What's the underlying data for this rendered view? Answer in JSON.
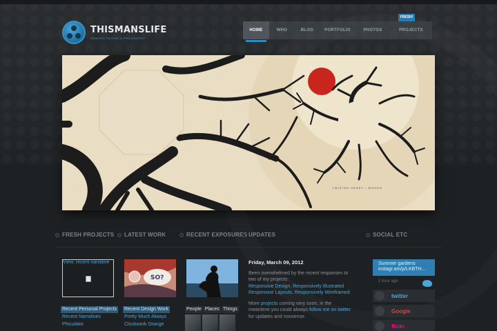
{
  "header": {
    "brand": "THISMANSLIFE",
    "tagline": "GRAPHIC DESIGN & PHILOSOPHY",
    "nav": [
      {
        "label": "HOME",
        "active": true
      },
      {
        "label": "WHO",
        "active": false
      },
      {
        "label": "BLOG",
        "active": false
      },
      {
        "label": "PORTFOLIO",
        "active": false
      },
      {
        "label": "PHOTOS",
        "active": false
      },
      {
        "label": "PROJECTS",
        "active": false
      }
    ],
    "badge": "FRESH!"
  },
  "hero": {
    "caption": "TWISTED HEART • WOODS",
    "colors": {
      "paper": "#e8dcc2",
      "ink": "#1c1c1c",
      "sun": "#c8261c"
    }
  },
  "sections": {
    "fresh_projects": "FRESH PROJECTS",
    "latest_work": "LATEST WORK",
    "recent_exposures": "RECENT EXPOSURES",
    "updates": "UPDATES",
    "social": "SOCIAL ETC"
  },
  "projects": {
    "alt_text": "View: recent narrative",
    "label": "Recent Personal Projects",
    "links": [
      "Recent Narratives",
      "Phiculator"
    ]
  },
  "work": {
    "label": "Recent Design Work",
    "links": [
      "Pretty Much Always",
      "Clockwork Orange"
    ]
  },
  "exposures": {
    "tabs": [
      "People",
      "Places",
      "Things"
    ]
  },
  "update": {
    "date": "Friday, March 09, 2012",
    "p1": "Been overwhelmed by the recent responses to two of my projects:",
    "link1": "Responsive Design, Responsively Illustrated",
    "link2": "Responsive Layouts, Responsively Wireframed",
    "p2_a": "More",
    "p2_link1": "projects",
    "p2_b": "coming very soon, in the meantime you could always",
    "p2_link2": "follow me on twitter",
    "p2_c": "for updates and nonsense."
  },
  "social": {
    "tweet": "Summer gardens instagr.am/p/LKBTH...",
    "ago": "1 hour ago",
    "services": [
      {
        "name": "twitter",
        "color": "#4aa6d8"
      },
      {
        "name": "Google",
        "color": "#d14836"
      },
      {
        "name": "flickr",
        "color": "#ff0084"
      }
    ]
  },
  "colors": {
    "accent": "#2f8ac2",
    "background": "#1e2124"
  }
}
